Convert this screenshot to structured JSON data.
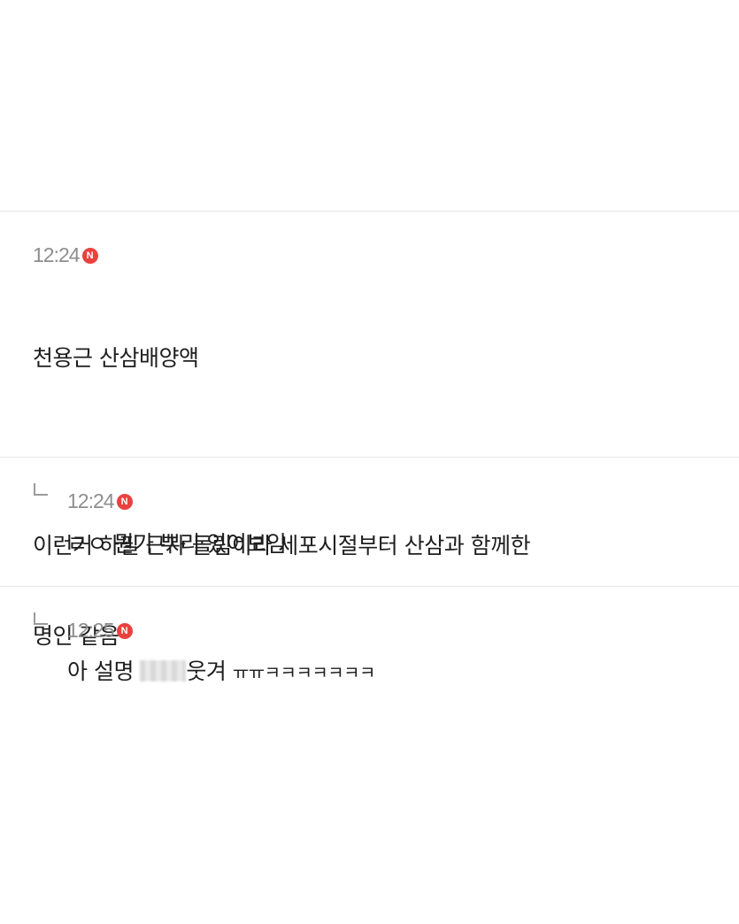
{
  "comments": [
    {
      "time": "12:24",
      "badge": "N",
      "lines": [
        "천용근 산삼배양액",
        "",
        "이런거 하필 근자 돌림이라 세포시절부터 산삼과 함께한",
        "명인 같음"
      ]
    },
    {
      "time": "12:24",
      "badge": "N",
      "text": "ㄹㅇ 뭔가 뿌리 있어보임"
    },
    {
      "time": "12:25",
      "badge": "N",
      "text_before": "아 설명 ",
      "text_after": "웃겨 ",
      "text_tail": "ㅠㅠㅋㅋㅋㅋㅋㅋㅋ"
    }
  ],
  "colors": {
    "badge": "#e8423f",
    "time": "#8e8e8e",
    "divider": "#e6e6e6"
  }
}
